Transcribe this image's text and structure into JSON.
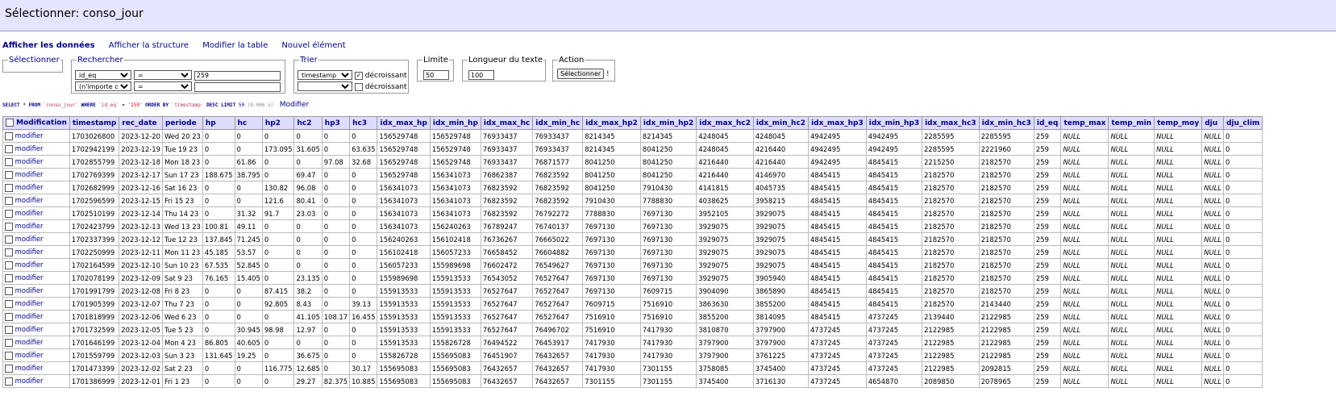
{
  "header": {
    "title": "Sélectionner: conso_jour"
  },
  "nav": [
    {
      "label": "Afficher les données",
      "current": true
    },
    {
      "label": "Afficher la structure"
    },
    {
      "label": "Modifier la table"
    },
    {
      "label": "Nouvel élément"
    }
  ],
  "select_box": {
    "legend": "Sélectionner"
  },
  "search": {
    "legend": "Rechercher",
    "rows": [
      {
        "column": "id_eq",
        "operator": "=",
        "value": "259"
      },
      {
        "column": "(n'importe où)",
        "operator": "=",
        "value": ""
      }
    ]
  },
  "sort": {
    "legend": "Trier",
    "rows": [
      {
        "column": "timestamp",
        "desc_checked": true,
        "desc_label": "décroissant"
      },
      {
        "column": "",
        "desc_checked": false,
        "desc_label": "décroissant"
      }
    ]
  },
  "limit": {
    "legend": "Limite",
    "value": "50"
  },
  "text_length": {
    "legend": "Longueur du texte",
    "value": "100"
  },
  "action": {
    "legend": "Action",
    "button": "Sélectionner",
    "bang": "!"
  },
  "sql": {
    "select": "SELECT",
    "star": "*",
    "from": "FROM",
    "table": "`conso_jour`",
    "where": "WHERE",
    "column": "`id_eq`",
    "eq": "=",
    "value": "'259'",
    "order_by": "ORDER BY",
    "order_col": "`timestamp`",
    "desc": "DESC",
    "limit": "LIMIT",
    "limit_val": "50",
    "time": "(0.006 s)",
    "edit_link": "Modifier"
  },
  "table": {
    "columns": [
      "Modification",
      "timestamp",
      "rec_date",
      "periode",
      "hp",
      "hc",
      "hp2",
      "hc2",
      "hp3",
      "hc3",
      "idx_max_hp",
      "idx_min_hp",
      "idx_max_hc",
      "idx_min_hc",
      "idx_max_hp2",
      "idx_min_hp2",
      "idx_max_hc2",
      "idx_min_hc2",
      "idx_max_hp3",
      "idx_min_hp3",
      "idx_max_hc3",
      "idx_min_hc3",
      "id_eq",
      "temp_max",
      "temp_min",
      "temp_moy",
      "dju",
      "dju_clim"
    ],
    "edit_label": "modifier",
    "rows": [
      [
        "1703026800",
        "2023-12-20",
        "Wed 20 23",
        "0",
        "0",
        "0",
        "0",
        "0",
        "0",
        "156529748",
        "156529748",
        "76933437",
        "76933437",
        "8214345",
        "8214345",
        "4248045",
        "4248045",
        "4942495",
        "4942495",
        "2285595",
        "2285595",
        "259",
        "NULL",
        "NULL",
        "NULL",
        "NULL",
        "0"
      ],
      [
        "1702942199",
        "2023-12-19",
        "Tue 19 23",
        "0",
        "0",
        "173.095",
        "31.605",
        "0",
        "63.635",
        "156529748",
        "156529748",
        "76933437",
        "76933437",
        "8214345",
        "8041250",
        "4248045",
        "4216440",
        "4942495",
        "4942495",
        "2285595",
        "2221960",
        "259",
        "NULL",
        "NULL",
        "NULL",
        "NULL",
        "0"
      ],
      [
        "1702855799",
        "2023-12-18",
        "Mon 18 23",
        "0",
        "61.86",
        "0",
        "0",
        "97.08",
        "32.68",
        "156529748",
        "156529748",
        "76933437",
        "76871577",
        "8041250",
        "8041250",
        "4216440",
        "4216440",
        "4942495",
        "4845415",
        "2215250",
        "2182570",
        "259",
        "NULL",
        "NULL",
        "NULL",
        "NULL",
        "0"
      ],
      [
        "1702769399",
        "2023-12-17",
        "Sun 17 23",
        "188.675",
        "38.795",
        "0",
        "69.47",
        "0",
        "0",
        "156529748",
        "156341073",
        "76862387",
        "76823592",
        "8041250",
        "8041250",
        "4216440",
        "4146970",
        "4845415",
        "4845415",
        "2182570",
        "2182570",
        "259",
        "NULL",
        "NULL",
        "NULL",
        "NULL",
        "0"
      ],
      [
        "1702682999",
        "2023-12-16",
        "Sat 16 23",
        "0",
        "0",
        "130.82",
        "96.08",
        "0",
        "0",
        "156341073",
        "156341073",
        "76823592",
        "76823592",
        "8041250",
        "7910430",
        "4141815",
        "4045735",
        "4845415",
        "4845415",
        "2182570",
        "2182570",
        "259",
        "NULL",
        "NULL",
        "NULL",
        "NULL",
        "0"
      ],
      [
        "1702596599",
        "2023-12-15",
        "Fri 15 23",
        "0",
        "0",
        "121.6",
        "80.41",
        "0",
        "0",
        "156341073",
        "156341073",
        "76823592",
        "76823592",
        "7910430",
        "7788830",
        "4038625",
        "3958215",
        "4845415",
        "4845415",
        "2182570",
        "2182570",
        "259",
        "NULL",
        "NULL",
        "NULL",
        "NULL",
        "0"
      ],
      [
        "1702510199",
        "2023-12-14",
        "Thu 14 23",
        "0",
        "31.32",
        "91.7",
        "23.03",
        "0",
        "0",
        "156341073",
        "156341073",
        "76823592",
        "76792272",
        "7788830",
        "7697130",
        "3952105",
        "3929075",
        "4845415",
        "4845415",
        "2182570",
        "2182570",
        "259",
        "NULL",
        "NULL",
        "NULL",
        "NULL",
        "0"
      ],
      [
        "1702423799",
        "2023-12-13",
        "Wed 13 23",
        "100.81",
        "49.11",
        "0",
        "0",
        "0",
        "0",
        "156341073",
        "156240263",
        "76789247",
        "76740137",
        "7697130",
        "7697130",
        "3929075",
        "3929075",
        "4845415",
        "4845415",
        "2182570",
        "2182570",
        "259",
        "NULL",
        "NULL",
        "NULL",
        "NULL",
        "0"
      ],
      [
        "1702337399",
        "2023-12-12",
        "Tue 12 23",
        "137.845",
        "71.245",
        "0",
        "0",
        "0",
        "0",
        "156240263",
        "156102418",
        "76736267",
        "76665022",
        "7697130",
        "7697130",
        "3929075",
        "3929075",
        "4845415",
        "4845415",
        "2182570",
        "2182570",
        "259",
        "NULL",
        "NULL",
        "NULL",
        "NULL",
        "0"
      ],
      [
        "1702250999",
        "2023-12-11",
        "Mon 11 23",
        "45.185",
        "53.57",
        "0",
        "0",
        "0",
        "0",
        "156102418",
        "156057233",
        "76658452",
        "76604882",
        "7697130",
        "7697130",
        "3929075",
        "3929075",
        "4845415",
        "4845415",
        "2182570",
        "2182570",
        "259",
        "NULL",
        "NULL",
        "NULL",
        "NULL",
        "0"
      ],
      [
        "1702164599",
        "2023-12-10",
        "Sun 10 23",
        "67.535",
        "52.845",
        "0",
        "0",
        "0",
        "0",
        "156057233",
        "155989698",
        "76602472",
        "76549627",
        "7697130",
        "7697130",
        "3929075",
        "3929075",
        "4845415",
        "4845415",
        "2182570",
        "2182570",
        "259",
        "NULL",
        "NULL",
        "NULL",
        "NULL",
        "0"
      ],
      [
        "1702078199",
        "2023-12-09",
        "Sat 9 23",
        "76.165",
        "15.405",
        "0",
        "23.135",
        "0",
        "0",
        "155989698",
        "155913533",
        "76543052",
        "76527647",
        "7697130",
        "7697130",
        "3929075",
        "3905940",
        "4845415",
        "4845415",
        "2182570",
        "2182570",
        "259",
        "NULL",
        "NULL",
        "NULL",
        "NULL",
        "0"
      ],
      [
        "1701991799",
        "2023-12-08",
        "Fri 8 23",
        "0",
        "0",
        "87.415",
        "38.2",
        "0",
        "0",
        "155913533",
        "155913533",
        "76527647",
        "76527647",
        "7697130",
        "7609715",
        "3904090",
        "3865890",
        "4845415",
        "4845415",
        "2182570",
        "2182570",
        "259",
        "NULL",
        "NULL",
        "NULL",
        "NULL",
        "0"
      ],
      [
        "1701905399",
        "2023-12-07",
        "Thu 7 23",
        "0",
        "0",
        "92.805",
        "8.43",
        "0",
        "39.13",
        "155913533",
        "155913533",
        "76527647",
        "76527647",
        "7609715",
        "7516910",
        "3863630",
        "3855200",
        "4845415",
        "4845415",
        "2182570",
        "2143440",
        "259",
        "NULL",
        "NULL",
        "NULL",
        "NULL",
        "0"
      ],
      [
        "1701818999",
        "2023-12-06",
        "Wed 6 23",
        "0",
        "0",
        "0",
        "41.105",
        "108.17",
        "16.455",
        "155913533",
        "155913533",
        "76527647",
        "76527647",
        "7516910",
        "7516910",
        "3855200",
        "3814095",
        "4845415",
        "4737245",
        "2139440",
        "2122985",
        "259",
        "NULL",
        "NULL",
        "NULL",
        "NULL",
        "0"
      ],
      [
        "1701732599",
        "2023-12-05",
        "Tue 5 23",
        "0",
        "30.945",
        "98.98",
        "12.97",
        "0",
        "0",
        "155913533",
        "155913533",
        "76527647",
        "76496702",
        "7516910",
        "7417930",
        "3810870",
        "3797900",
        "4737245",
        "4737245",
        "2122985",
        "2122985",
        "259",
        "NULL",
        "NULL",
        "NULL",
        "NULL",
        "0"
      ],
      [
        "1701646199",
        "2023-12-04",
        "Mon 4 23",
        "86.805",
        "40.605",
        "0",
        "0",
        "0",
        "0",
        "155913533",
        "155826728",
        "76494522",
        "76453917",
        "7417930",
        "7417930",
        "3797900",
        "3797900",
        "4737245",
        "4737245",
        "2122985",
        "2122985",
        "259",
        "NULL",
        "NULL",
        "NULL",
        "NULL",
        "0"
      ],
      [
        "1701559799",
        "2023-12-03",
        "Sun 3 23",
        "131.645",
        "19.25",
        "0",
        "36.675",
        "0",
        "0",
        "155826728",
        "155695083",
        "76451907",
        "76432657",
        "7417930",
        "7417930",
        "3797900",
        "3761225",
        "4737245",
        "4737245",
        "2122985",
        "2122985",
        "259",
        "NULL",
        "NULL",
        "NULL",
        "NULL",
        "0"
      ],
      [
        "1701473399",
        "2023-12-02",
        "Sat 2 23",
        "0",
        "0",
        "116.775",
        "12.685",
        "0",
        "30.17",
        "155695083",
        "155695083",
        "76432657",
        "76432657",
        "7417930",
        "7301155",
        "3758085",
        "3745400",
        "4737245",
        "4737245",
        "2122985",
        "2092815",
        "259",
        "NULL",
        "NULL",
        "NULL",
        "NULL",
        "0"
      ],
      [
        "1701386999",
        "2023-12-01",
        "Fri 1 23",
        "0",
        "0",
        "0",
        "29.27",
        "82.375",
        "10.885",
        "155695083",
        "155695083",
        "76432657",
        "76432657",
        "7301155",
        "7301155",
        "3745400",
        "3716130",
        "4737245",
        "4654870",
        "2089850",
        "2078965",
        "259",
        "NULL",
        "NULL",
        "NULL",
        "NULL",
        "0"
      ]
    ]
  }
}
